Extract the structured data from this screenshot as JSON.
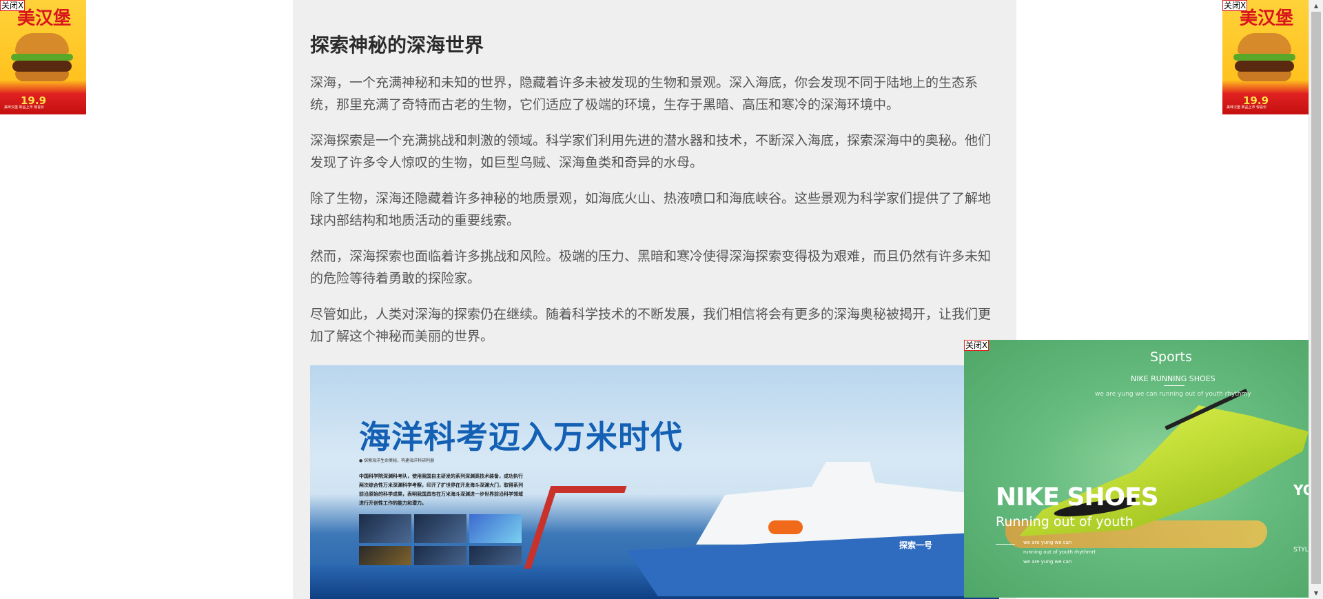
{
  "article": {
    "title": "探索神秘的深海世界",
    "paragraphs": [
      "深海，一个充满神秘和未知的世界，隐藏着许多未被发现的生物和景观。深入海底，你会发现不同于陆地上的生态系统，那里充满了奇特而古老的生物，它们适应了极端的环境，生存于黑暗、高压和寒冷的深海环境中。",
      "深海探索是一个充满挑战和刺激的领域。科学家们利用先进的潜水器和技术，不断深入海底，探索深海中的奥秘。他们发现了许多令人惊叹的生物，如巨型乌贼、深海鱼类和奇异的水母。",
      "除了生物，深海还隐藏着许多神秘的地质景观，如海底火山、热液喷口和海底峡谷。这些景观为科学家们提供了了解地球内部结构和地质活动的重要线索。",
      "然而，深海探索也面临着许多挑战和风险。极端的压力、黑暗和寒冷使得深海探索变得极为艰难，而且仍然有许多未知的危险等待着勇敢的探险家。",
      "尽管如此，人类对深海的探索仍在继续。随着科学技术的不断发展，我们相信将会有更多的深海奥秘被揭开，让我们更加了解这个神秘而美丽的世界。"
    ]
  },
  "hero": {
    "title": "海洋科考迈入万米时代",
    "subtitle": "● 探索海洋生命奥秘，构建海洋科研利器",
    "body": "中国科学院深渊科考队，使用我国自主研发的系列深渊高技术装备，成功执行两次综合性万米深渊科学考察，印开了扩世界在开发海斗深渊大门，取得系列前沿原始的科学成果，表明我国具有在万米海斗深渊进一步世界前沿科学领域进行开创性工作的能力和潜力。",
    "ship_name": "探索一号"
  },
  "ads": {
    "close_label": "关闭X",
    "burger": {
      "title": "美汉堡",
      "price": "19.9",
      "small_text": "美味汉堡 新品上市 惊喜价"
    },
    "nike": {
      "heading": "Sports",
      "subheading": "NIKE RUNNING SHOES",
      "tagline": "we are yung  we can running out of youth rhythmy",
      "big_title": "NIKE SHOES",
      "sub_title": "Running out of youth",
      "lines": [
        "we are yung  we can",
        "running out of youth rhythmrt",
        "we are yung  we can"
      ],
      "side_text": "YO",
      "style_text": "STYLE"
    }
  },
  "icons": {
    "scroll_up": "▲",
    "scroll_down": "▼"
  }
}
